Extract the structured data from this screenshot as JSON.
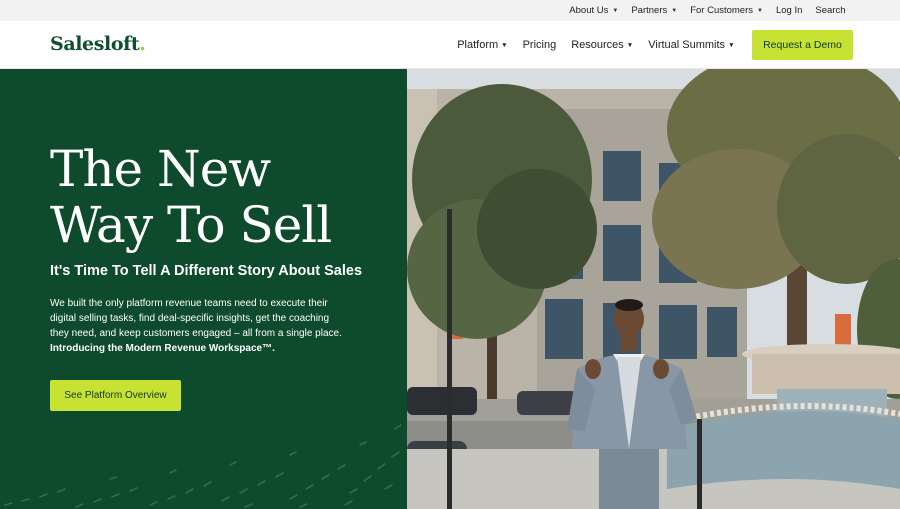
{
  "utility_nav": {
    "items": [
      {
        "label": "About Us",
        "dropdown": true
      },
      {
        "label": "Partners",
        "dropdown": true
      },
      {
        "label": "For Customers",
        "dropdown": true
      },
      {
        "label": "Log In",
        "dropdown": false
      },
      {
        "label": "Search",
        "dropdown": false
      }
    ]
  },
  "header": {
    "logo_text": "Salesloft",
    "logo_dot": ".",
    "nav": [
      {
        "label": "Platform",
        "dropdown": true
      },
      {
        "label": "Pricing",
        "dropdown": false
      },
      {
        "label": "Resources",
        "dropdown": true
      },
      {
        "label": "Virtual Summits",
        "dropdown": true
      }
    ],
    "cta_label": "Request a Demo"
  },
  "hero": {
    "title_line1": "The New",
    "title_line2": "Way To Sell",
    "subtitle": "It's Time To Tell A Different Story About Sales",
    "body": "We built the only platform revenue teams need to execute their digital selling tasks, find deal-specific insights, get the coaching they need, and keep customers engaged – all from a single place.",
    "body_strong": "Introducing the Modern Revenue Workspace™.",
    "button_label": "See Platform Overview"
  },
  "colors": {
    "brand_green": "#0e4a2c",
    "accent_lime": "#c8e234",
    "utility_bg": "#f2f2f2"
  },
  "icons": {
    "dropdown": "chevron-down-icon"
  }
}
